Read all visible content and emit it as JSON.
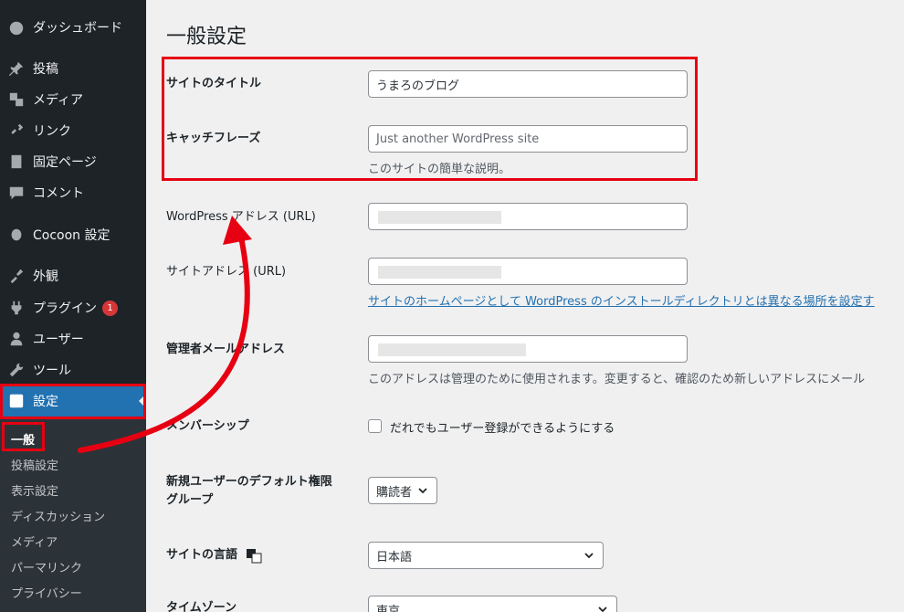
{
  "sidebar": {
    "items": [
      {
        "label": "ダッシュボード",
        "icon": "dashboard-icon"
      },
      {
        "label": "投稿",
        "icon": "pin-icon"
      },
      {
        "label": "メディア",
        "icon": "media-icon"
      },
      {
        "label": "リンク",
        "icon": "link-icon"
      },
      {
        "label": "固定ページ",
        "icon": "page-icon"
      },
      {
        "label": "コメント",
        "icon": "comment-icon"
      },
      {
        "label": "Cocoon 設定",
        "icon": "cocoon-icon"
      },
      {
        "label": "外観",
        "icon": "appearance-icon"
      },
      {
        "label": "プラグイン",
        "icon": "plugin-icon",
        "badge": "1"
      },
      {
        "label": "ユーザー",
        "icon": "user-icon"
      },
      {
        "label": "ツール",
        "icon": "wrench-icon"
      },
      {
        "label": "設定",
        "icon": "settings-icon"
      }
    ],
    "submenu": [
      "一般",
      "投稿設定",
      "表示設定",
      "ディスカッション",
      "メディア",
      "パーマリンク",
      "プライバシー"
    ]
  },
  "page": {
    "title": "一般設定",
    "site_title_label": "サイトのタイトル",
    "site_title_value": "うまろのブログ",
    "tagline_label": "キャッチフレーズ",
    "tagline_placeholder": "Just another WordPress site",
    "tagline_desc": "このサイトの簡単な説明。",
    "wp_address_label": "WordPress アドレス (URL)",
    "site_address_label": "サイトアドレス (URL)",
    "site_address_link": "サイトのホームページとして WordPress のインストールディレクトリとは異なる場所を設定す",
    "admin_email_label": "管理者メールアドレス",
    "admin_email_desc": "このアドレスは管理のために使用されます。変更すると、確認のため新しいアドレスにメール",
    "membership_label": "メンバーシップ",
    "membership_checkbox": "だれでもユーザー登録ができるようにする",
    "default_role_label_1": "新規ユーザーのデフォルト権限",
    "default_role_label_2": "グループ",
    "default_role_value": "購読者",
    "language_label": "サイトの言語",
    "language_value": "日本語",
    "timezone_label": "タイムゾーン",
    "timezone_value": "東京"
  },
  "colors": {
    "annotation": "#e60012",
    "sidebar_bg": "#1d2327",
    "active_bg": "#2271b1"
  }
}
